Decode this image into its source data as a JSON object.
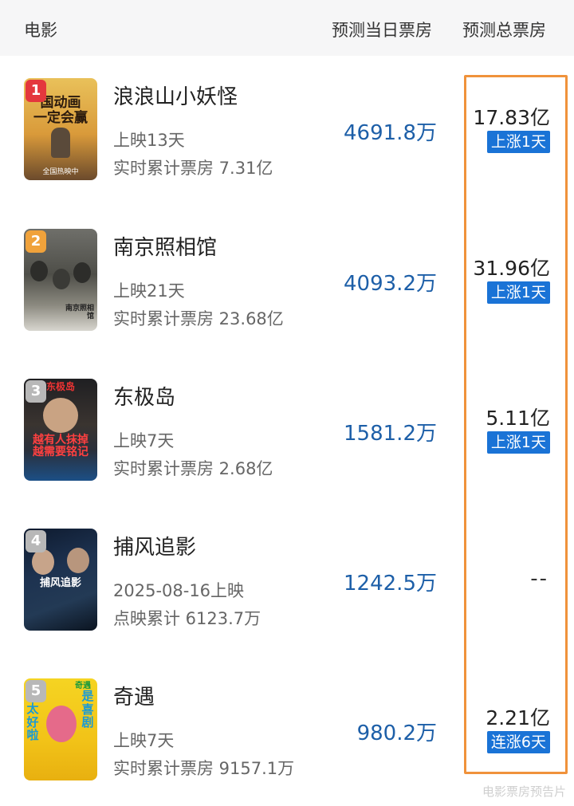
{
  "header": {
    "col_movie": "电影",
    "col_daily": "预测当日票房",
    "col_total": "预测总票房"
  },
  "movies": [
    {
      "rank": "1",
      "title": "浪浪山小妖怪",
      "line1": "上映13天",
      "line2": "实时累计票房 7.31亿",
      "daily": "4691.8万",
      "total": "17.83亿",
      "badge": "上涨1天",
      "poster_text": "国动画\n一定会赢",
      "poster_footer": "全国热映中"
    },
    {
      "rank": "2",
      "title": "南京照相馆",
      "line1": "上映21天",
      "line2": "实时累计票房 23.68亿",
      "daily": "4093.2万",
      "total": "31.96亿",
      "badge": "上涨1天",
      "poster_text": "南京照相馆"
    },
    {
      "rank": "3",
      "title": "东极岛",
      "line1": "上映7天",
      "line2": "实时累计票房 2.68亿",
      "daily": "1581.2万",
      "total": "5.11亿",
      "badge": "上涨1天",
      "poster_text": "越有人抹掉\n越需要铭记",
      "poster_top": "东极岛"
    },
    {
      "rank": "4",
      "title": "捕风追影",
      "line1": "2025-08-16上映",
      "line2": "点映累计 6123.7万",
      "daily": "1242.5万",
      "total": "--",
      "badge": "",
      "poster_text": "捕风追影"
    },
    {
      "rank": "5",
      "title": "奇遇",
      "line1": "上映7天",
      "line2": "实时累计票房 9157.1万",
      "daily": "980.2万",
      "total": "2.21亿",
      "badge": "连涨6天",
      "poster_text_left": "太好啦",
      "poster_text_right": "是喜剧",
      "poster_top": "奇遇"
    }
  ],
  "watermark": "电影票房预告片",
  "colors": {
    "accent_blue": "#1a73d6",
    "daily_blue": "#1d5fa8",
    "highlight_orange": "#f0923b",
    "rank_1": "#e4373d",
    "rank_2": "#f0a23b",
    "rank_other": "#b8b8b8"
  }
}
